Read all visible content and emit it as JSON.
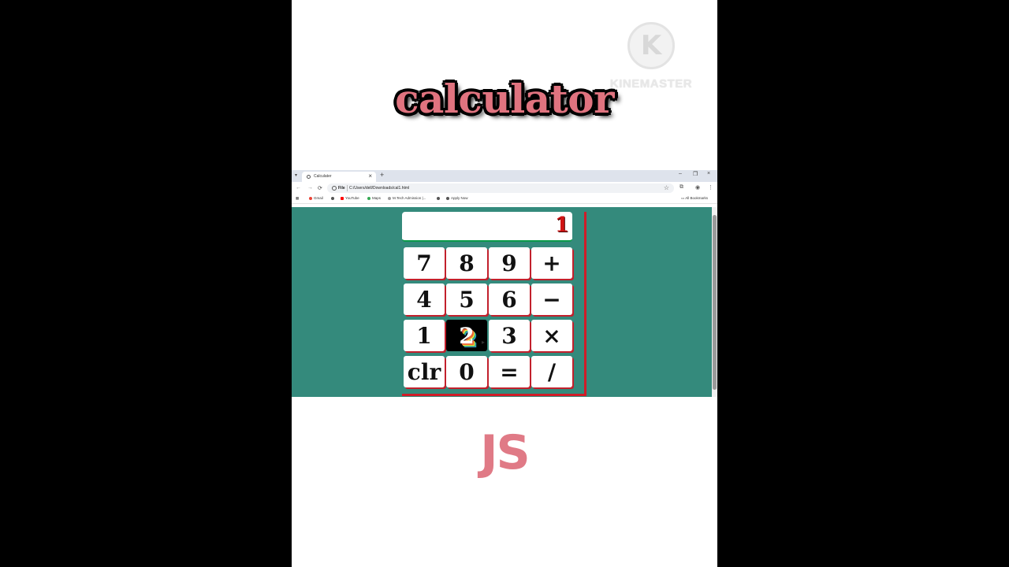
{
  "overlay": {
    "title": "calculator",
    "subtitle": "JS",
    "watermark_text": "KINEMASTER",
    "watermark_logo_letter": "K"
  },
  "browser": {
    "tab_title": "Calculater",
    "tab_close": "×",
    "new_tab": "+",
    "window_controls": [
      "–",
      "❐",
      "×"
    ],
    "nav": {
      "back": "←",
      "forward": "→",
      "reload": "⟳"
    },
    "address_scheme": "File",
    "url": "C:/Users/dell/Downloads/cal1.html",
    "bookmarks": [
      {
        "label": "Gmail",
        "color": "#ea4335"
      },
      {
        "label": "",
        "color": "#555555"
      },
      {
        "label": "YouTube",
        "color": "#ff0000"
      },
      {
        "label": "Maps",
        "color": "#34a853"
      },
      {
        "label": "M.Tech Admission |...",
        "color": "#9e9e9e"
      },
      {
        "label": "",
        "color": "#555555"
      },
      {
        "label": "Apply Now",
        "color": "#555555"
      }
    ],
    "all_bookmarks": "All Bookmarks"
  },
  "calculator": {
    "display": "1",
    "keys": [
      [
        "7",
        "8",
        "9",
        "+"
      ],
      [
        "4",
        "5",
        "6",
        "−"
      ],
      [
        "1",
        "2",
        "3",
        "×"
      ],
      [
        "clr",
        "0",
        "=",
        "/"
      ]
    ],
    "pressed_key": "2"
  },
  "colors": {
    "page_bg": "#348a7c",
    "accent_red": "#d01c28",
    "title_pink": "#e0737f"
  }
}
